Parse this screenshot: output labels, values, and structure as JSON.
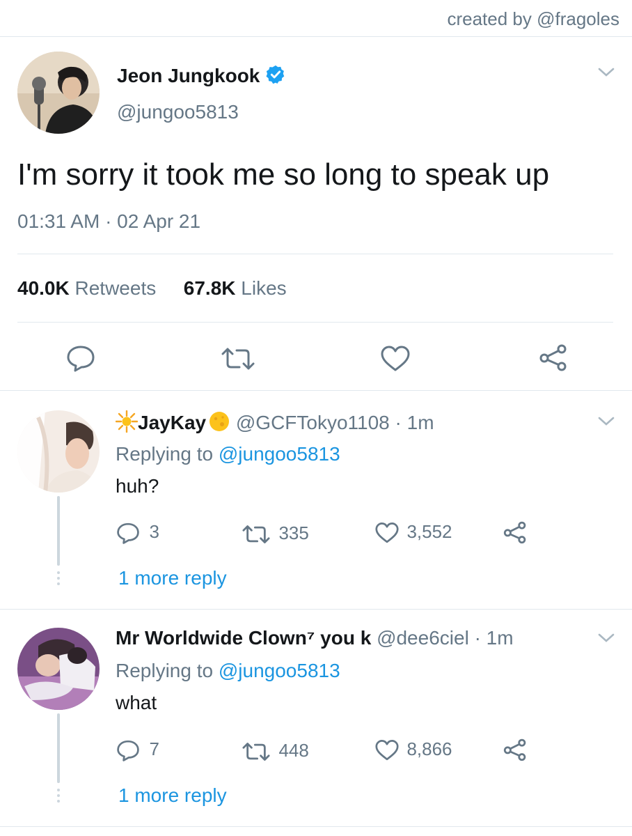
{
  "credit": "created by @fragoles",
  "main_tweet": {
    "name": "Jeon Jungkook",
    "handle": "@jungoo5813",
    "text": "I'm sorry it took me so long to speak up",
    "timestamp": "01:31 AM · 02 Apr 21",
    "retweets_count": "40.0K",
    "retweets_label": "Retweets",
    "likes_count": "67.8K",
    "likes_label": "Likes"
  },
  "replies": [
    {
      "name": "JayKay",
      "handle": "@GCFTokyo1108",
      "time": "· 1m",
      "replying_prefix": "Replying to",
      "replying_to": "@jungoo5813",
      "text": "huh?",
      "reply_count": "3",
      "retweet_count": "335",
      "like_count": "3,552",
      "more_replies": "1 more reply"
    },
    {
      "name": "Mr Worldwide Clown⁷ you k",
      "handle": "@dee6ciel",
      "time": "· 1m",
      "replying_prefix": "Replying to",
      "replying_to": "@jungoo5813",
      "text": "what",
      "reply_count": "7",
      "retweet_count": "448",
      "like_count": "8,866",
      "more_replies": "1 more reply"
    }
  ],
  "colors": {
    "accent": "#1b95e0",
    "muted": "#657786",
    "divider": "#e1e8ed"
  }
}
